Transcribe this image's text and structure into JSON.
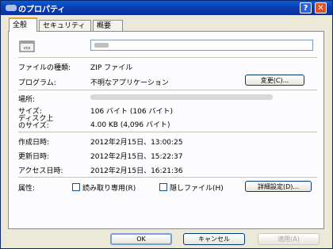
{
  "window": {
    "title": "のプロパティ",
    "help_icon": "?",
    "close_icon": "✕"
  },
  "tabs": [
    {
      "label": "全般",
      "active": true
    },
    {
      "label": "セキュリティ",
      "active": false
    },
    {
      "label": "概要",
      "active": false
    }
  ],
  "general": {
    "file_icon_text": "vcx",
    "file_type_label": "ファイルの種類:",
    "file_type_value": "ZIP ファイル",
    "program_label": "プログラム:",
    "program_value": "不明なアプリケーション",
    "change_button": "変更(C)...",
    "location_label": "場所:",
    "size_label": "サイズ:",
    "size_value": "106 バイト (106 バイト)",
    "disk_size_label_line1": "ディスク上",
    "disk_size_label_line2": "のサイズ:",
    "disk_size_value": "4.00 KB (4,096 バイト)",
    "created_label": "作成日時:",
    "created_value": "2012年2月15日、13:00:25",
    "modified_label": "更新日時:",
    "modified_value": "2012年2月15日、15:22:37",
    "accessed_label": "アクセス日時:",
    "accessed_value": "2012年2月15日、16:21:36",
    "attributes_label": "属性:",
    "readonly_label": "読み取り専用(R)",
    "hidden_label": "隠しファイル(H)",
    "advanced_button": "詳細設定(D)..."
  },
  "footer": {
    "ok": "OK",
    "cancel": "キャンセル",
    "apply": "適用(A)"
  },
  "colors": {
    "titlebar": "#0a3fb5",
    "dialog_bg": "#ece9d8",
    "panel_bg": "#fcfcfe",
    "tab_highlight": "#e5a42a"
  }
}
